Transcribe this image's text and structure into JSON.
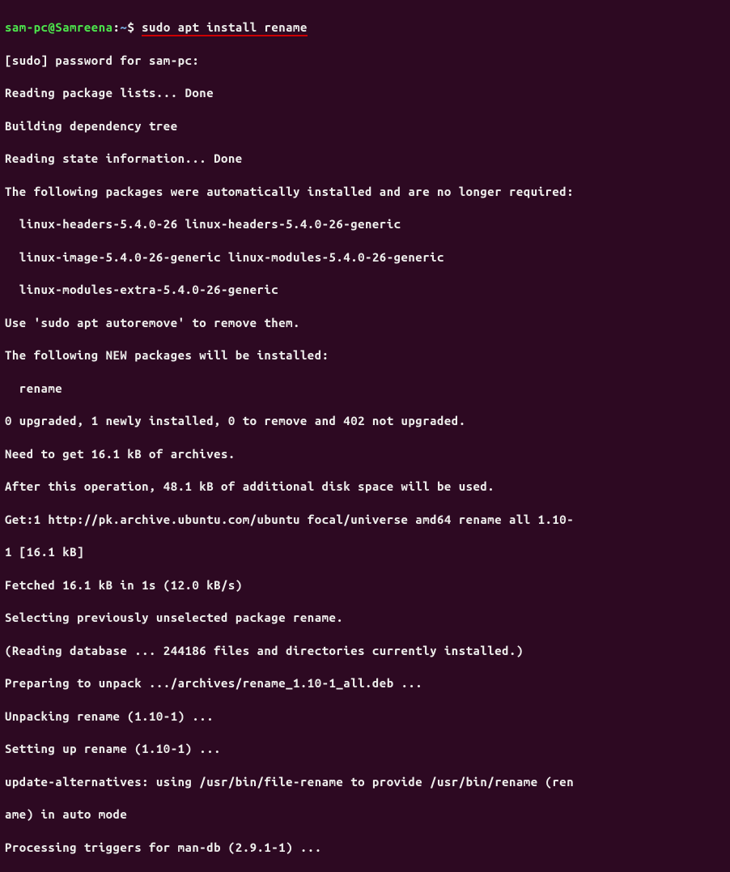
{
  "prompt": {
    "user_host": "sam-pc@Samreena",
    "separator": ":",
    "path": "~",
    "symbol": "$"
  },
  "command": "sudo apt install rename",
  "output": [
    "[sudo] password for sam-pc:",
    "Reading package lists... Done",
    "Building dependency tree",
    "Reading state information... Done",
    "The following packages were automatically installed and are no longer required:",
    "  linux-headers-5.4.0-26 linux-headers-5.4.0-26-generic",
    "  linux-image-5.4.0-26-generic linux-modules-5.4.0-26-generic",
    "  linux-modules-extra-5.4.0-26-generic",
    "Use 'sudo apt autoremove' to remove them.",
    "The following NEW packages will be installed:",
    "  rename",
    "0 upgraded, 1 newly installed, 0 to remove and 402 not upgraded.",
    "Need to get 16.1 kB of archives.",
    "After this operation, 48.1 kB of additional disk space will be used.",
    "Get:1 http://pk.archive.ubuntu.com/ubuntu focal/universe amd64 rename all 1.10-",
    "1 [16.1 kB]",
    "Fetched 16.1 kB in 1s (12.0 kB/s)",
    "Selecting previously unselected package rename.",
    "(Reading database ... 244186 files and directories currently installed.)",
    "Preparing to unpack .../archives/rename_1.10-1_all.deb ...",
    "Unpacking rename (1.10-1) ...",
    "Setting up rename (1.10-1) ...",
    "update-alternatives: using /usr/bin/file-rename to provide /usr/bin/rename (ren",
    "ame) in auto mode",
    "Processing triggers for man-db (2.9.1-1) ..."
  ]
}
